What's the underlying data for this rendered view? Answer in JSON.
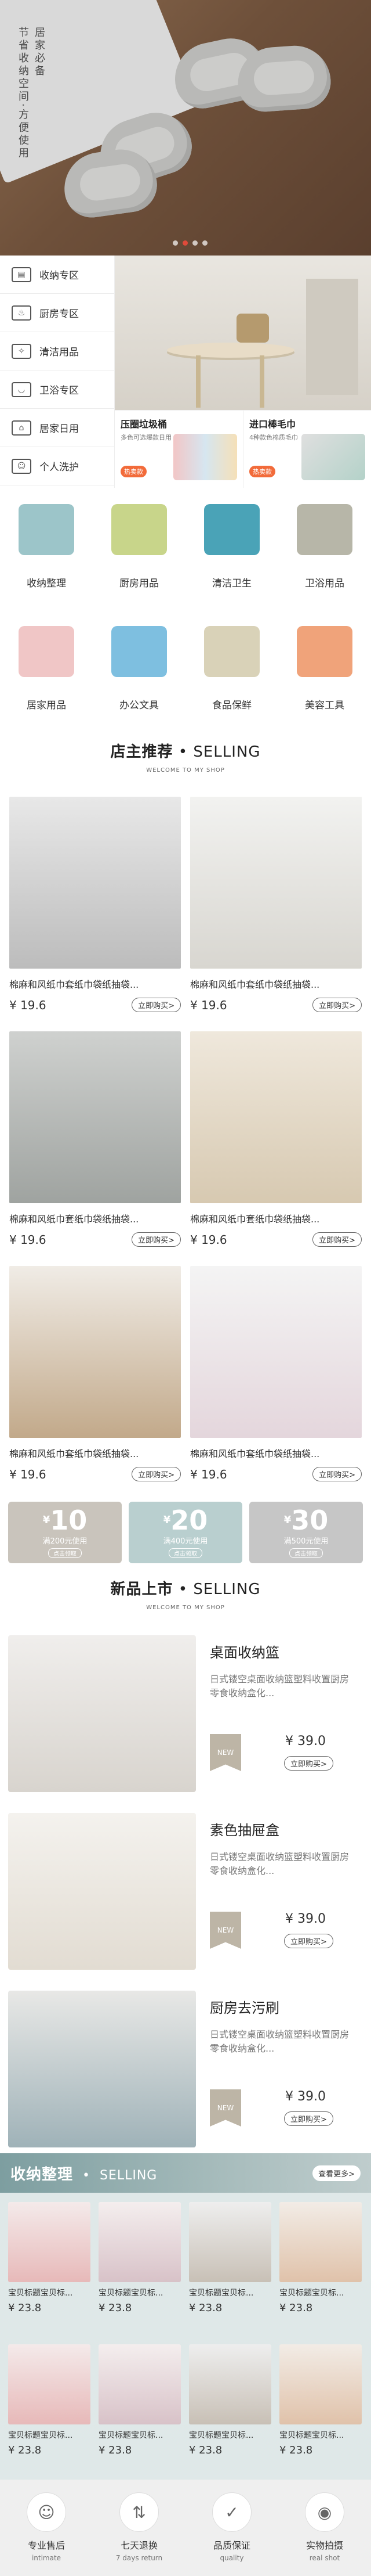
{
  "hero": {
    "tagline": [
      "居家必备",
      "节省收纳空间·方便使用"
    ],
    "dots": 4,
    "active_dot": 1
  },
  "menu": {
    "items": [
      {
        "label": "收纳专区",
        "icon": "storage-box-icon"
      },
      {
        "label": "厨房专区",
        "icon": "kitchen-icon"
      },
      {
        "label": "清洁用品",
        "icon": "cleaning-icon"
      },
      {
        "label": "卫浴专区",
        "icon": "bathroom-icon"
      },
      {
        "label": "居家日用",
        "icon": "home-daily-icon"
      },
      {
        "label": "个人洗护",
        "icon": "personal-care-icon"
      }
    ]
  },
  "promos": [
    {
      "title": "压圈垃圾桶",
      "subtitle": "多色可选爆款日用",
      "tag": "热卖款"
    },
    {
      "title": "进口棒毛巾",
      "subtitle": "4种款色棉质毛巾",
      "tag": "热卖款"
    }
  ],
  "categories": [
    {
      "label": "收纳整理",
      "color": "#9cc5c9"
    },
    {
      "label": "厨房用品",
      "color": "#c8d58a"
    },
    {
      "label": "清洁卫生",
      "color": "#4aa3b7"
    },
    {
      "label": "卫浴用品",
      "color": "#b7b6a8"
    },
    {
      "label": "居家用品",
      "color": "#f0c6c6"
    },
    {
      "label": "办公文具",
      "color": "#7ebfe0"
    },
    {
      "label": "食品保鲜",
      "color": "#d9d2b8"
    },
    {
      "label": "美容工具",
      "color": "#f0a37a"
    }
  ],
  "shop_recommend": {
    "title_main": "店主推荐",
    "title_en": "SELLING",
    "subtitle": "WELCOME TO MY SHOP"
  },
  "products": [
    {
      "name": "棉麻和风纸巾套纸巾袋纸抽袋...",
      "price": "¥ 19.6",
      "buy": "立即购买>"
    },
    {
      "name": "棉麻和风纸巾套纸巾袋纸抽袋...",
      "price": "¥ 19.6",
      "buy": "立即购买>"
    },
    {
      "name": "棉麻和风纸巾套纸巾袋纸抽袋...",
      "price": "¥ 19.6",
      "buy": "立即购买>"
    },
    {
      "name": "棉麻和风纸巾套纸巾袋纸抽袋...",
      "price": "¥ 19.6",
      "buy": "立即购买>"
    },
    {
      "name": "棉麻和风纸巾套纸巾袋纸抽袋...",
      "price": "¥ 19.6",
      "buy": "立即购买>"
    },
    {
      "name": "棉麻和风纸巾套纸巾袋纸抽袋...",
      "price": "¥ 19.6",
      "buy": "立即购买>"
    }
  ],
  "coupons": [
    {
      "currency": "¥",
      "amount": "10",
      "desc": "满200元使用",
      "btn": "点击领取"
    },
    {
      "currency": "¥",
      "amount": "20",
      "desc": "满400元使用",
      "btn": "点击领取"
    },
    {
      "currency": "¥",
      "amount": "30",
      "desc": "满500元使用",
      "btn": "点击领取"
    }
  ],
  "new_arrivals": {
    "title_main": "新品上市",
    "title_en": "SELLING",
    "subtitle": "WELCOME TO MY SHOP",
    "items": [
      {
        "title": "桌面收纳篮",
        "desc": "日式镂空桌面收纳篮塑料收置厨房零食收纳盒化...",
        "badge": "NEW",
        "price": "¥ 39.0",
        "buy": "立即购买>"
      },
      {
        "title": "素色抽屉盒",
        "desc": "日式镂空桌面收纳篮塑料收置厨房零食收纳盒化...",
        "badge": "NEW",
        "price": "¥ 39.0",
        "buy": "立即购买>"
      },
      {
        "title": "厨房去污刷",
        "desc": "日式镂空桌面收纳篮塑料收置厨房零食收纳盒化...",
        "badge": "NEW",
        "price": "¥ 39.0",
        "buy": "立即购买>"
      }
    ]
  },
  "storage_section": {
    "title": "收纳整理",
    "title_en": "SELLING",
    "more": "查看更多>",
    "items": [
      {
        "name": "宝贝标题宝贝标...",
        "price": "¥ 23.8"
      },
      {
        "name": "宝贝标题宝贝标...",
        "price": "¥ 23.8"
      },
      {
        "name": "宝贝标题宝贝标...",
        "price": "¥ 23.8"
      },
      {
        "name": "宝贝标题宝贝标...",
        "price": "¥ 23.8"
      },
      {
        "name": "宝贝标题宝贝标...",
        "price": "¥ 23.8"
      },
      {
        "name": "宝贝标题宝贝标...",
        "price": "¥ 23.8"
      },
      {
        "name": "宝贝标题宝贝标...",
        "price": "¥ 23.8"
      },
      {
        "name": "宝贝标题宝贝标...",
        "price": "¥ 23.8"
      }
    ]
  },
  "services": [
    {
      "icon": "customer-service-icon",
      "glyph": "☺",
      "label": "专业售后",
      "en": "intimate"
    },
    {
      "icon": "return-icon",
      "glyph": "⇅",
      "label": "七天退换",
      "en": "7 days return"
    },
    {
      "icon": "thumbs-up-icon",
      "glyph": "✓",
      "label": "品质保证",
      "en": "quality"
    },
    {
      "icon": "camera-icon",
      "glyph": "◉",
      "label": "实物拍摄",
      "en": "real shot"
    }
  ]
}
